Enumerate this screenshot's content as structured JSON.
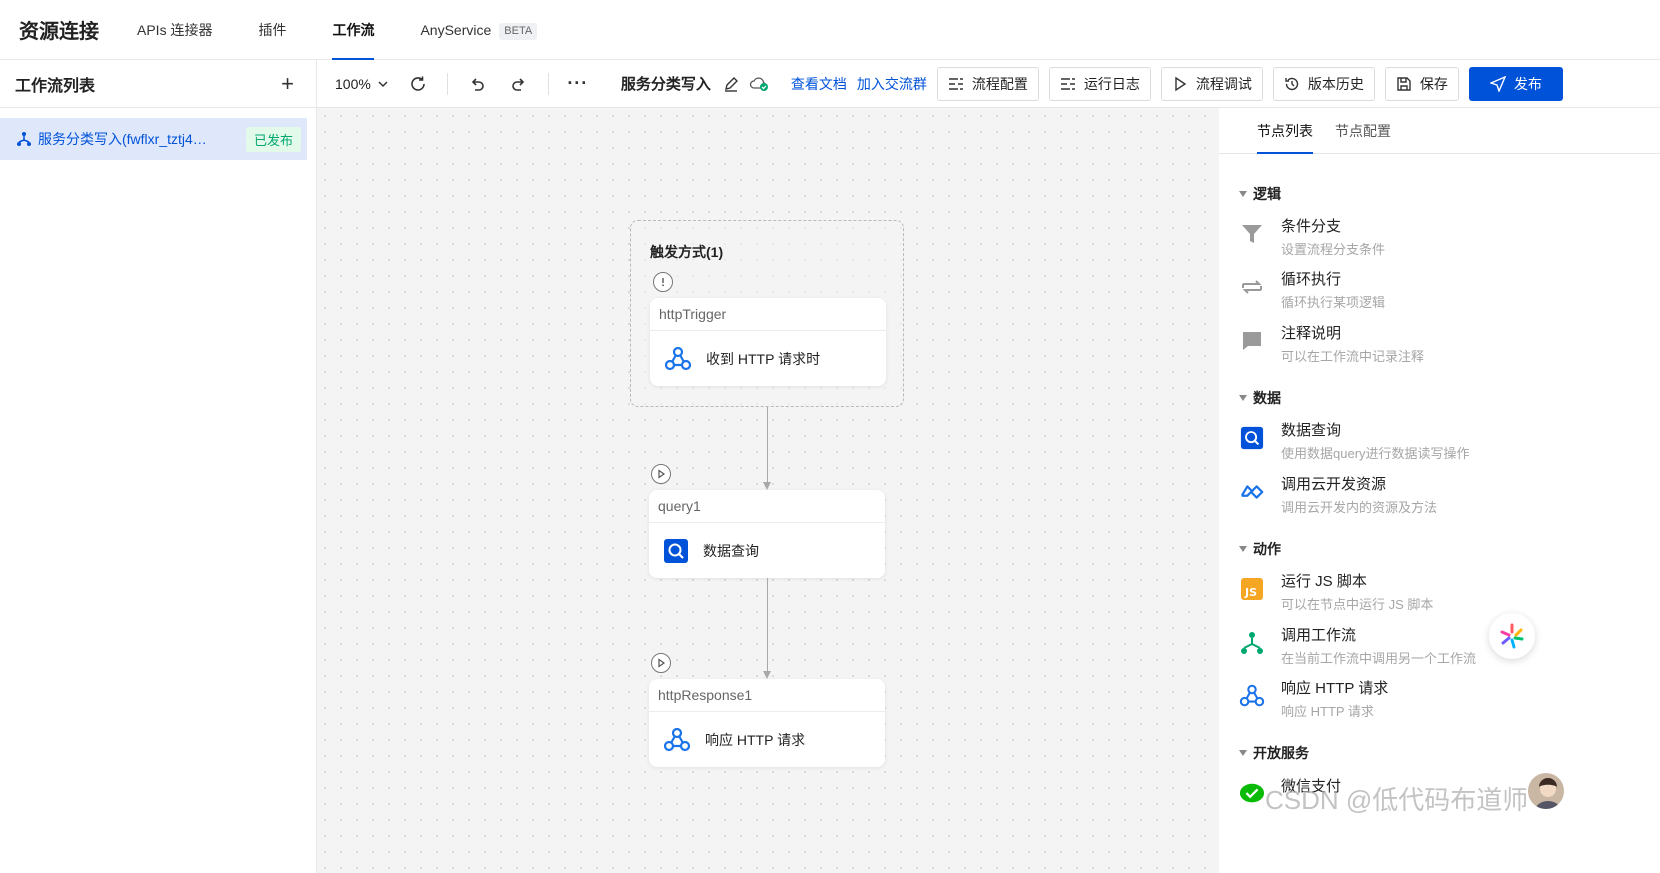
{
  "topnav": {
    "brand": "资源连接",
    "tabs": [
      {
        "label": "APIs 连接器"
      },
      {
        "label": "插件"
      },
      {
        "label": "工作流"
      },
      {
        "label": "AnyService"
      }
    ],
    "beta": "BETA"
  },
  "left": {
    "title": "工作流列表",
    "item": {
      "name": "服务分类写入(fwflxr_tztj4…",
      "status": "已发布"
    }
  },
  "toolbar": {
    "zoom": "100%",
    "more": "···",
    "workflow_name": "服务分类写入",
    "link_docs": "查看文档",
    "link_group": "加入交流群",
    "btn_config": "流程配置",
    "btn_log": "运行日志",
    "btn_debug": "流程调试",
    "btn_history": "版本历史",
    "btn_save": "保存",
    "btn_publish": "发布"
  },
  "canvas": {
    "trigger_title": "触发方式(1)",
    "nodes": [
      {
        "id": "httpTrigger",
        "label": "收到 HTTP 请求时"
      },
      {
        "id": "query1",
        "label": "数据查询"
      },
      {
        "id": "httpResponse1",
        "label": "响应 HTTP 请求"
      }
    ]
  },
  "right": {
    "tabs": [
      "节点列表",
      "节点配置"
    ],
    "sections": [
      {
        "title": "逻辑",
        "items": [
          {
            "title": "条件分支",
            "desc": "设置流程分支条件",
            "icon": "filter-icon"
          },
          {
            "title": "循环执行",
            "desc": "循环执行某项逻辑",
            "icon": "loop-icon"
          },
          {
            "title": "注释说明",
            "desc": "可以在工作流中记录注释",
            "icon": "comment-icon"
          }
        ]
      },
      {
        "title": "数据",
        "items": [
          {
            "title": "数据查询",
            "desc": "使用数据query进行数据读写操作",
            "icon": "query-icon"
          },
          {
            "title": "调用云开发资源",
            "desc": "调用云开发内的资源及方法",
            "icon": "cloud-icon"
          }
        ]
      },
      {
        "title": "动作",
        "items": [
          {
            "title": "运行 JS 脚本",
            "desc": "可以在节点中运行 JS 脚本",
            "icon": "js-icon"
          },
          {
            "title": "调用工作流",
            "desc": "在当前工作流中调用另一个工作流",
            "icon": "workflow-icon"
          },
          {
            "title": "响应 HTTP 请求",
            "desc": "响应 HTTP 请求",
            "icon": "webhook-icon"
          }
        ]
      },
      {
        "title": "开放服务",
        "items": [
          {
            "title": "微信支付",
            "desc": "",
            "icon": "wechat-pay-icon"
          }
        ]
      }
    ]
  },
  "watermark": "CSDN @低代码布道师",
  "colors": {
    "primary": "#0052d9",
    "success": "#00a870",
    "selected_bg": "#dfe8fb"
  }
}
